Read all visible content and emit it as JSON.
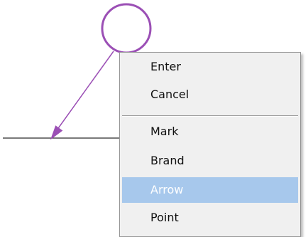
{
  "canvas": {
    "line_color": "#2b2b2b",
    "shape_color": "#9b4fb5"
  },
  "context_menu": {
    "items": [
      {
        "label": "Enter",
        "state": "normal"
      },
      {
        "label": "Cancel",
        "state": "normal"
      },
      {
        "label": "Mark",
        "state": "normal"
      },
      {
        "label": "Brand",
        "state": "normal"
      },
      {
        "label": "Arrow",
        "state": "highlighted"
      },
      {
        "label": "Point",
        "state": "normal"
      }
    ],
    "highlight_color": "#a7c8ec",
    "background_color": "#f0f0f0"
  }
}
